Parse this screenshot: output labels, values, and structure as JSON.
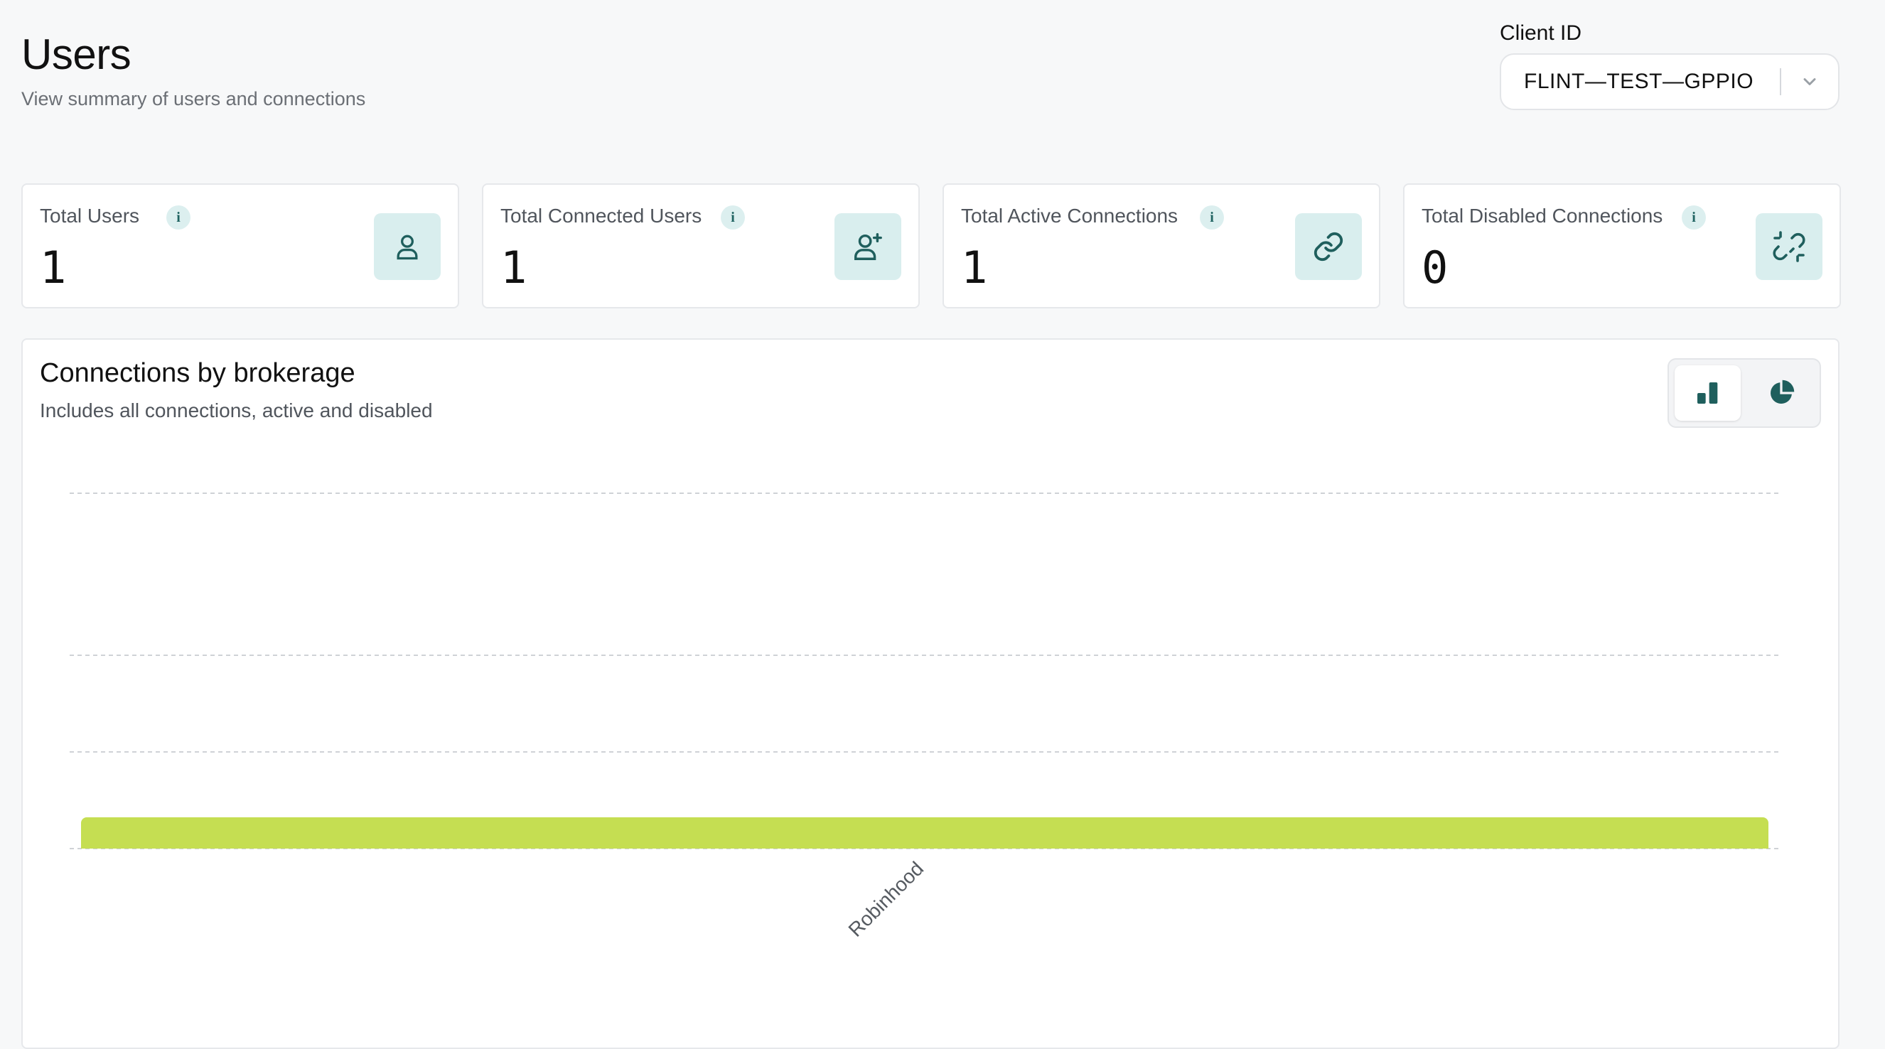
{
  "header": {
    "title": "Users",
    "subtitle": "View summary of users and connections"
  },
  "client": {
    "label": "Client ID",
    "selected": "FLINT—TEST—GPPIO"
  },
  "stats": [
    {
      "label": "Total Users",
      "value": "1",
      "icon": "user-icon"
    },
    {
      "label": "Total Connected Users",
      "value": "1",
      "icon": "user-plus-icon"
    },
    {
      "label": "Total Active Connections",
      "value": "1",
      "icon": "link-icon"
    },
    {
      "label": "Total Disabled Connections",
      "value": "0",
      "icon": "broken-link-icon"
    }
  ],
  "info_glyph": "i",
  "chart_section": {
    "title": "Connections by brokerage",
    "subtitle": "Includes all connections, active and disabled",
    "view_options": [
      "bar-chart-icon",
      "pie-chart-icon"
    ],
    "active_view": "bar"
  },
  "colors": {
    "accent": "#c5de52",
    "icon_dark": "#1f5f5d",
    "icon_bg": "#d9eeee"
  },
  "chart_data": {
    "type": "bar",
    "categories": [
      "Robinhood"
    ],
    "values": [
      1
    ],
    "grid": true,
    "gridlines": [
      0,
      1,
      2,
      3,
      4
    ]
  }
}
